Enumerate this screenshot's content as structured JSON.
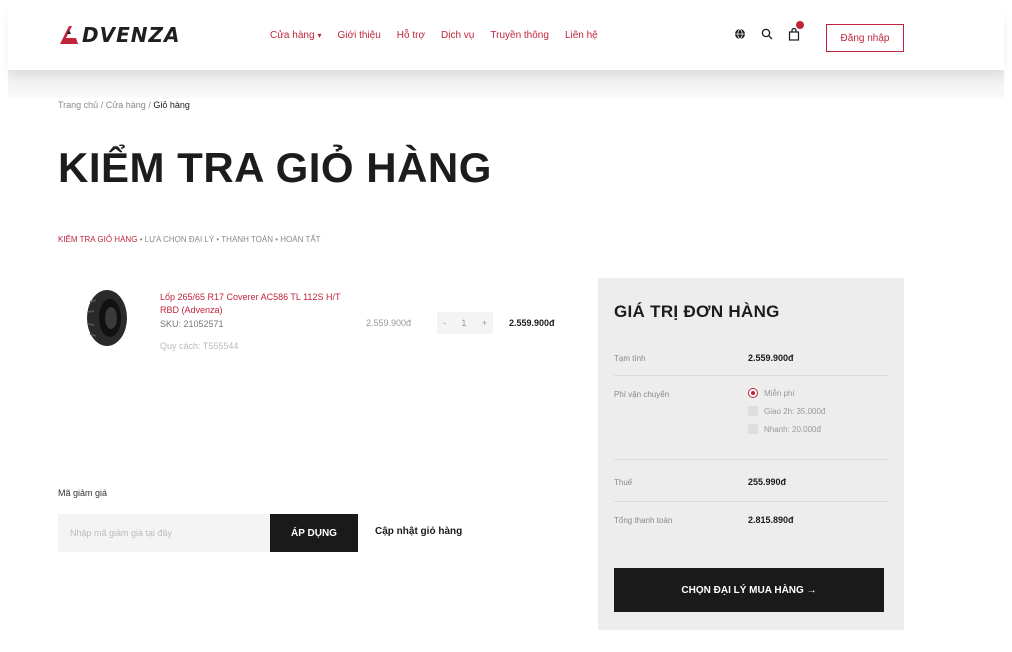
{
  "header": {
    "logo_text": "DVENZA",
    "logo_alt": "ADVENZA",
    "nav": [
      {
        "label": "Cửa hàng",
        "has_caret": true
      },
      {
        "label": "Giới thiệu"
      },
      {
        "label": "Hỗ trợ"
      },
      {
        "label": "Dịch vụ"
      },
      {
        "label": "Truyền thông"
      },
      {
        "label": "Liên hệ"
      }
    ],
    "caret": "▾",
    "login_label": "Đăng nhập",
    "icons": [
      "globe-icon",
      "search-icon",
      "cart-icon"
    ]
  },
  "breadcrumb": {
    "home": "Trang chủ",
    "shop": "Cửa hàng",
    "current": "Giỏ hàng",
    "sep": "/"
  },
  "page_title": "KIỂM TRA GIỎ HÀNG",
  "steps": {
    "active": "KIỂM TRA GIỎ HÀNG",
    "rest": " • LỰA CHỌN ĐẠI LÝ • THANH TOÁN • HOÀN TẤT"
  },
  "cart_item": {
    "name": "Lốp 265/65 R17 Coverer AC586 TL 112S H/T RBD (Advenza)",
    "sku": "SKU: 21052571",
    "spec": "Quy cách: T555544",
    "price": "2.559.900đ",
    "qty_minus": "-",
    "qty": "1",
    "qty_plus": "+",
    "total": "2.559.900đ"
  },
  "coupon": {
    "label": "Mã giảm giá",
    "placeholder": "Nhập mã giảm giá tại đây",
    "apply_label": "ÁP DỤNG",
    "update_label": "Cập nhật giỏ hàng"
  },
  "summary": {
    "title": "GIÁ TRỊ ĐƠN HÀNG",
    "subtotal_label": "Tạm tính",
    "subtotal_value": "2.559.900đ",
    "shipping_label": "Phí vận chuyển",
    "shipping_options": [
      {
        "label": "Miễn phí",
        "selected": true
      },
      {
        "label": "Giao 2h: 35.000đ",
        "selected": false
      },
      {
        "label": "Nhanh: 20.000đ",
        "selected": false
      }
    ],
    "tax_label": "Thuế",
    "tax_value": "255.990đ",
    "total_label": "Tổng thanh toán",
    "total_value": "2.815.890đ",
    "checkout_label": "CHỌN ĐẠI LÝ MUA HÀNG →"
  },
  "colors": {
    "brand": "#c0243a",
    "dark": "#1a1a1a",
    "panel": "#ededed"
  }
}
